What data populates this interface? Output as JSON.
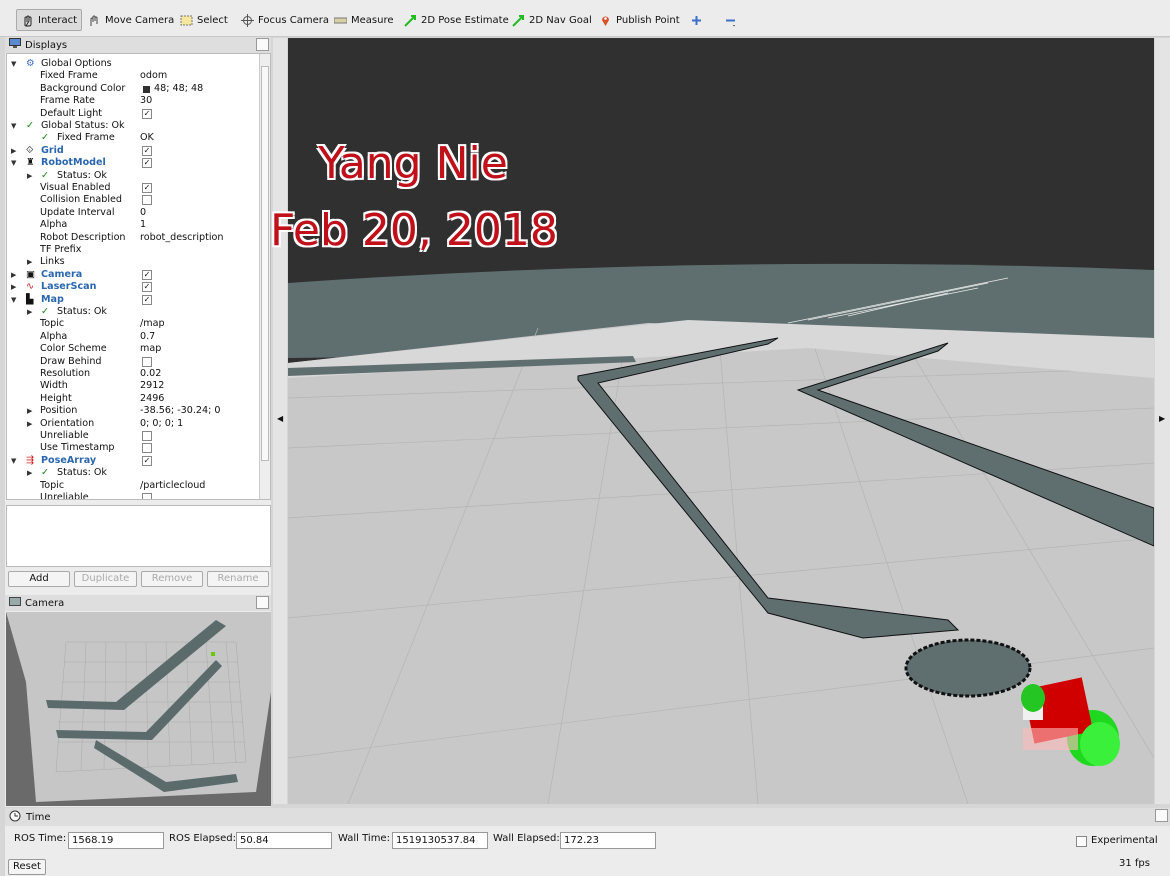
{
  "toolbar": {
    "interact": "Interact",
    "move_camera": "Move Camera",
    "select": "Select",
    "focus_camera": "Focus Camera",
    "measure": "Measure",
    "pose_estimate": "2D Pose Estimate",
    "nav_goal": "2D Nav Goal",
    "publish_point": "Publish Point"
  },
  "displays": {
    "title": "Displays",
    "rows": {
      "r0": {
        "label": "Global Options"
      },
      "r1": {
        "label": "Fixed Frame",
        "value": "odom"
      },
      "r2": {
        "label": "Background Color",
        "value": "48; 48; 48"
      },
      "r3": {
        "label": "Frame Rate",
        "value": "30"
      },
      "r4": {
        "label": "Default Light"
      },
      "r5": {
        "label": "Global Status: Ok"
      },
      "r6": {
        "label": "Fixed Frame",
        "value": "OK"
      },
      "r7": {
        "label": "Grid"
      },
      "r8": {
        "label": "RobotModel"
      },
      "r9": {
        "label": "Status: Ok"
      },
      "r10": {
        "label": "Visual Enabled"
      },
      "r11": {
        "label": "Collision Enabled"
      },
      "r12": {
        "label": "Update Interval",
        "value": "0"
      },
      "r13": {
        "label": "Alpha",
        "value": "1"
      },
      "r14": {
        "label": "Robot Description",
        "value": "robot_description"
      },
      "r15": {
        "label": "TF Prefix"
      },
      "r16": {
        "label": "Links"
      },
      "r17": {
        "label": "Camera"
      },
      "r18": {
        "label": "LaserScan"
      },
      "r19": {
        "label": "Map"
      },
      "r20": {
        "label": "Status: Ok"
      },
      "r21": {
        "label": "Topic",
        "value": "/map"
      },
      "r22": {
        "label": "Alpha",
        "value": "0.7"
      },
      "r23": {
        "label": "Color Scheme",
        "value": "map"
      },
      "r24": {
        "label": "Draw Behind"
      },
      "r25": {
        "label": "Resolution",
        "value": "0.02"
      },
      "r26": {
        "label": "Width",
        "value": "2912"
      },
      "r27": {
        "label": "Height",
        "value": "2496"
      },
      "r28": {
        "label": "Position",
        "value": "-38.56; -30.24; 0"
      },
      "r29": {
        "label": "Orientation",
        "value": "0; 0; 0; 1"
      },
      "r30": {
        "label": "Unreliable"
      },
      "r31": {
        "label": "Use Timestamp"
      },
      "r32": {
        "label": "PoseArray"
      },
      "r33": {
        "label": "Status: Ok"
      },
      "r34": {
        "label": "Topic",
        "value": "/particlecloud"
      },
      "r35": {
        "label": "Unreliable"
      }
    },
    "buttons": {
      "add": "Add",
      "duplicate": "Duplicate",
      "remove": "Remove",
      "rename": "Rename"
    }
  },
  "camera_panel": {
    "title": "Camera"
  },
  "overlay": {
    "line1": "Yang Nie",
    "line2": "Feb 20, 2018"
  },
  "time_panel": {
    "title": "Time",
    "ros_time_label": "ROS Time:",
    "ros_time": "1568.19",
    "ros_elapsed_label": "ROS Elapsed:",
    "ros_elapsed": "50.84",
    "wall_time_label": "Wall Time:",
    "wall_time": "1519130537.84",
    "wall_elapsed_label": "Wall Elapsed:",
    "wall_elapsed": "172.23",
    "experimental_label": "Experimental",
    "reset_label": "Reset",
    "fps": "31 fps"
  },
  "colors": {
    "background": "#303030",
    "floor": "#c9c9c9",
    "map_dark": "#607070",
    "overlay_text": "#c0101a",
    "link_blue": "#2a66b0"
  }
}
